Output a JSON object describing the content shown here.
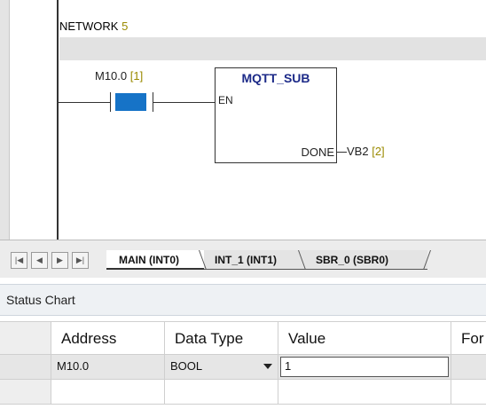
{
  "network": {
    "label": "NETWORK",
    "number": "5"
  },
  "contact": {
    "address": "M10.0",
    "ref": "[1]"
  },
  "function_block": {
    "title": "MQTT_SUB",
    "en_pin": "EN",
    "done_pin": "DONE"
  },
  "output": {
    "address": "VB2",
    "ref": "[2]"
  },
  "tabs": {
    "nav": [
      "|◀",
      "◀",
      "▶",
      "▶|"
    ],
    "items": [
      "MAIN (INT0)",
      "INT_1 (INT1)",
      "SBR_0 (SBR0)"
    ],
    "active": "MAIN (INT0)"
  },
  "status_chart": {
    "title": "Status Chart",
    "columns": [
      "Address",
      "Data Type",
      "Value",
      "For"
    ],
    "rows": [
      {
        "address": "M10.0",
        "data_type": "BOOL",
        "value": "1",
        "force": ""
      },
      {
        "address": "",
        "data_type": "",
        "value": "",
        "force": ""
      }
    ]
  },
  "colors": {
    "contact_active": "#1673c7",
    "block_title": "#1c2a88",
    "ref_text": "#9a8a00"
  }
}
